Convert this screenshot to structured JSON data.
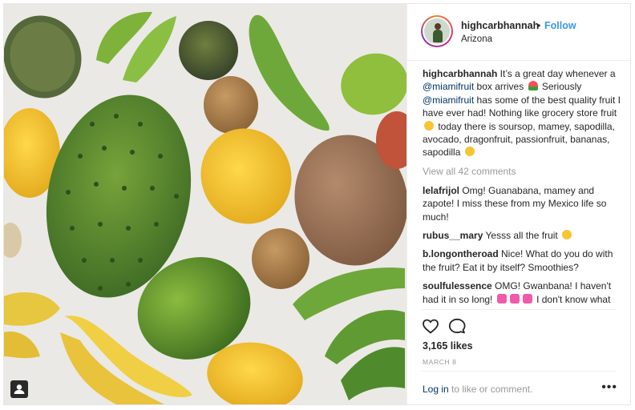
{
  "post": {
    "username": "highcarbhannah",
    "dot": "•",
    "follow_label": "Follow",
    "location": "Arizona",
    "caption": {
      "author": "highcarbhannah",
      "text1": " It’s a great day whenever a ",
      "mention1": "@miamifruit",
      "text2": " box arrives ",
      "text3": " Seriously ",
      "mention2": "@miamifruit",
      "text4": " has some of the best quality fruit I have ever had! Nothing like grocery store fruit ",
      "text5": " today there is soursop, mamey, sapodilla, avocado, dragonfruit, passionfruit, bananas, sapodilla "
    },
    "view_all_comments": "View all 42 comments",
    "comments": [
      {
        "user": "lelafrijol",
        "text": " Omg! Guanabana, mamey and zapote! I miss these from my Mexico life so much!"
      },
      {
        "user": "rubus__mary",
        "text": " Yesss all the fruit "
      },
      {
        "user": "b.longontheroad",
        "text": " Nice! What do you do with the fruit? Eat it by itself? Smoothies?"
      },
      {
        "user": "soulfulessence",
        "text": " OMG! Gwanbana! I haven't had it in so long! ",
        "text_after": " I don't know what you call it in English. Maybe sapadilo? Enjoy!!!"
      }
    ],
    "likes": "3,165 likes",
    "date": "MARCH 8",
    "footer": {
      "login_label": "Log in",
      "rest": " to like or comment.",
      "more_label": "•••"
    }
  },
  "icons": [
    "heart-icon",
    "comment-icon",
    "user-tag-icon",
    "watermelon-emoji",
    "smile-emoji",
    "yum-emoji",
    "pink-heart-emoji"
  ],
  "colors": {
    "link": "#003569",
    "follow": "#3897f0",
    "muted": "#999999",
    "text": "#262626"
  }
}
